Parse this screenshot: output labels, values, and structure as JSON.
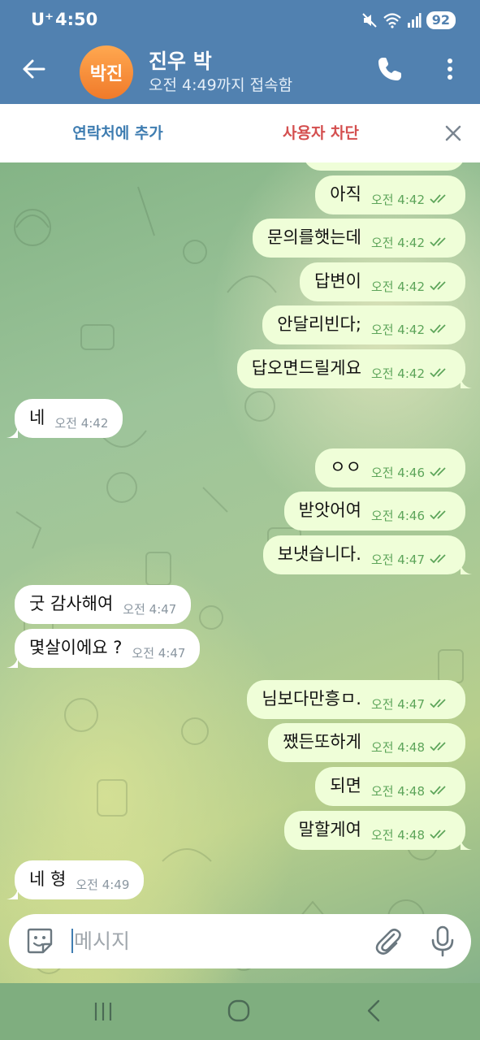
{
  "status_bar": {
    "carrier": "U⁺",
    "time": "4:50",
    "battery": "92"
  },
  "header": {
    "avatar_initials": "박진",
    "contact_name": "진우 박",
    "last_seen": "오전 4:49까지 접속함"
  },
  "action_bar": {
    "add_contact": "연락처에 추가",
    "block_user": "사용자 차단"
  },
  "messages": [
    {
      "dir": "out",
      "text": "아직",
      "time": "오전 4:42",
      "read": true
    },
    {
      "dir": "out",
      "text": "문의를햇는데",
      "time": "오전 4:42",
      "read": true
    },
    {
      "dir": "out",
      "text": "답변이",
      "time": "오전 4:42",
      "read": true
    },
    {
      "dir": "out",
      "text": "안달리빈다;",
      "time": "오전 4:42",
      "read": true
    },
    {
      "dir": "out",
      "text": "답오면드릴게요",
      "time": "오전 4:42",
      "read": true
    },
    {
      "dir": "in",
      "text": "네",
      "time": "오전 4:42"
    },
    {
      "dir": "out",
      "text": "ㅇㅇ",
      "time": "오전 4:46",
      "read": true
    },
    {
      "dir": "out",
      "text": "받앗어여",
      "time": "오전 4:46",
      "read": true
    },
    {
      "dir": "out",
      "text": "보냇습니다.",
      "time": "오전 4:47",
      "read": true
    },
    {
      "dir": "in",
      "text": "굿 감사해여",
      "time": "오전 4:47"
    },
    {
      "dir": "in",
      "text": "몇살이에요 ?",
      "time": "오전 4:47"
    },
    {
      "dir": "out",
      "text": "님보다만흥ㅁ.",
      "time": "오전 4:47",
      "read": true
    },
    {
      "dir": "out",
      "text": "쨌든또하게",
      "time": "오전 4:48",
      "read": true
    },
    {
      "dir": "out",
      "text": "되면",
      "time": "오전 4:48",
      "read": true
    },
    {
      "dir": "out",
      "text": "말할게여",
      "time": "오전 4:48",
      "read": true
    },
    {
      "dir": "in",
      "text": "네 형",
      "time": "오전 4:49"
    }
  ],
  "composer": {
    "placeholder": "메시지"
  },
  "colors": {
    "header_bg": "#5181b0",
    "avatar_bg": "#f5883a",
    "outgoing_bubble": "#effed8",
    "incoming_bubble": "#ffffff",
    "outgoing_time": "#5da55a",
    "add_contact_text": "#3f7db1",
    "block_user_text": "#d44f4f"
  },
  "icons": [
    "back-arrow-icon",
    "phone-icon",
    "more-vert-icon",
    "close-icon",
    "double-check-icon",
    "sticker-icon",
    "attach-paperclip-icon",
    "microphone-icon",
    "mute-icon",
    "wifi-icon",
    "signal-icon"
  ]
}
